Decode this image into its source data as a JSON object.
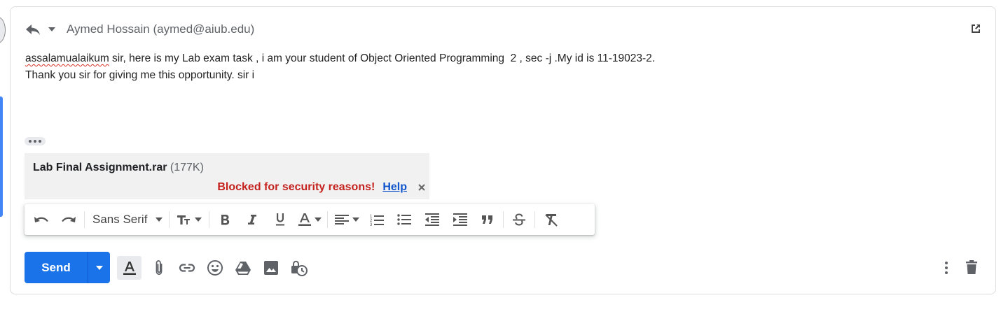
{
  "header": {
    "recipient": "Aymed Hossain (aymed@aiub.edu)",
    "icons": {
      "reply": "reply-icon",
      "reply_menu": "chevron-down-icon",
      "popout": "popout-icon"
    }
  },
  "body": {
    "line1_misspelled": "assalamualaikum",
    "line1_rest": " sir, here is my Lab exam task , i am your student of Object Oriented Programming  2 , sec -j .My id is 11-19023-2.",
    "line2": "Thank you sir for giving me this opportunity. sir i"
  },
  "attachment": {
    "name": "Lab Final Assignment.rar",
    "size": "(177K)",
    "status": "Blocked for security reasons!",
    "help_label": "Help"
  },
  "formatting_toolbar": {
    "font": "Sans Serif",
    "icons": [
      "undo-icon",
      "redo-icon",
      "font-size-icon",
      "bold-icon",
      "italic-icon",
      "underline-icon",
      "text-color-icon",
      "align-icon",
      "numbered-list-icon",
      "bulleted-list-icon",
      "indent-less-icon",
      "indent-more-icon",
      "quote-icon",
      "strikethrough-icon",
      "remove-formatting-icon"
    ]
  },
  "actions": {
    "send_label": "Send",
    "icons": [
      "formatting-options-icon",
      "attach-file-icon",
      "insert-link-icon",
      "emoji-icon",
      "google-drive-icon",
      "insert-photo-icon",
      "confidential-mode-icon",
      "more-options-icon",
      "discard-draft-icon"
    ]
  },
  "colors": {
    "send_button": "#1a73e8",
    "blocked_text": "#c5221f",
    "help_link": "#1155cc",
    "accent": "#4285f4"
  }
}
